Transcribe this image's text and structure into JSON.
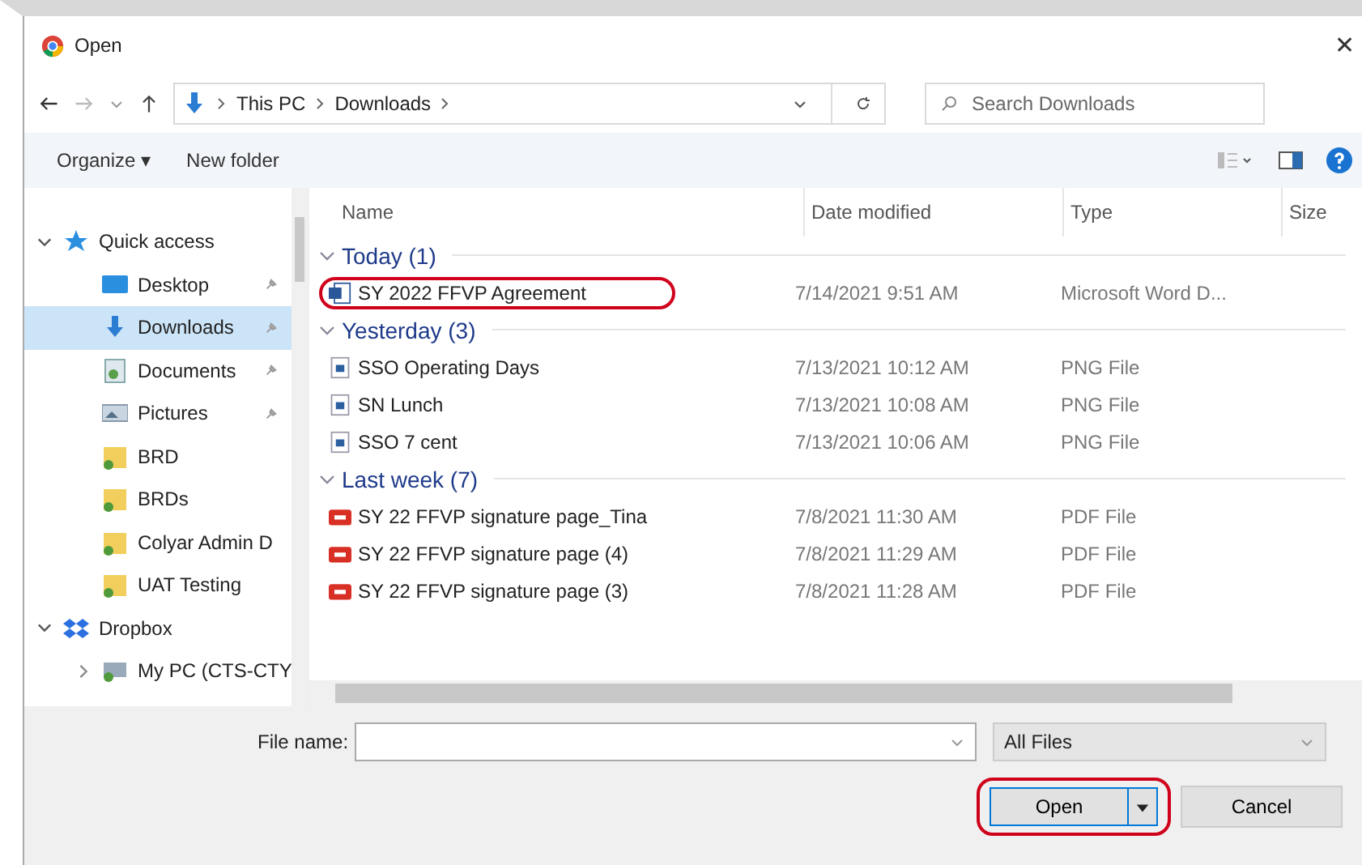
{
  "window": {
    "title": "Open",
    "close": "✕"
  },
  "address": {
    "crumbs": [
      "This PC",
      "Downloads"
    ],
    "search_placeholder": "Search Downloads"
  },
  "toolbar": {
    "organize": "Organize ▾",
    "new_folder": "New folder"
  },
  "sidebar": [
    {
      "label": "Quick access",
      "kind": "star",
      "expanded": true,
      "selected": false,
      "children": [
        {
          "label": "Desktop",
          "kind": "desktop",
          "pinned": true,
          "selected": false
        },
        {
          "label": "Downloads",
          "kind": "download",
          "pinned": true,
          "selected": true
        },
        {
          "label": "Documents",
          "kind": "document",
          "pinned": true,
          "selected": false
        },
        {
          "label": "Pictures",
          "kind": "pictures",
          "pinned": true,
          "selected": false
        },
        {
          "label": "BRD",
          "kind": "folder",
          "pinned": false,
          "selected": false
        },
        {
          "label": "BRDs",
          "kind": "folder",
          "pinned": false,
          "selected": false
        },
        {
          "label": "Colyar Admin D",
          "kind": "folder",
          "pinned": false,
          "selected": false
        },
        {
          "label": "UAT Testing",
          "kind": "folder",
          "pinned": false,
          "selected": false
        }
      ]
    },
    {
      "label": "Dropbox",
      "kind": "dropbox",
      "expanded": true,
      "selected": false,
      "children": [
        {
          "label": "My PC (CTS-CTY",
          "kind": "pc",
          "expanded": false,
          "selected": false
        }
      ]
    }
  ],
  "columns": [
    "Name",
    "Date modified",
    "Type",
    "Size"
  ],
  "groups": [
    {
      "label": "Today (1)",
      "files": [
        {
          "name": "SY 2022 FFVP Agreement",
          "date": "7/14/2021 9:51 AM",
          "type": "Microsoft Word D...",
          "kind": "word",
          "highlighted": true
        }
      ]
    },
    {
      "label": "Yesterday (3)",
      "files": [
        {
          "name": "SSO Operating Days",
          "date": "7/13/2021 10:12 AM",
          "type": "PNG File",
          "kind": "png",
          "highlighted": false
        },
        {
          "name": "SN Lunch",
          "date": "7/13/2021 10:08 AM",
          "type": "PNG File",
          "kind": "png",
          "highlighted": false
        },
        {
          "name": "SSO 7 cent",
          "date": "7/13/2021 10:06 AM",
          "type": "PNG File",
          "kind": "png",
          "highlighted": false
        }
      ]
    },
    {
      "label": "Last week (7)",
      "files": [
        {
          "name": "SY 22 FFVP signature page_Tina",
          "date": "7/8/2021 11:30 AM",
          "type": "PDF File",
          "kind": "pdf",
          "highlighted": false
        },
        {
          "name": "SY 22 FFVP signature page (4)",
          "date": "7/8/2021 11:29 AM",
          "type": "PDF File",
          "kind": "pdf",
          "highlighted": false
        },
        {
          "name": "SY 22 FFVP signature page (3)",
          "date": "7/8/2021 11:28 AM",
          "type": "PDF File",
          "kind": "pdf",
          "highlighted": false
        }
      ]
    }
  ],
  "footer": {
    "file_name_label": "File name:",
    "filter": "All Files",
    "open": "Open",
    "open_highlighted": true,
    "cancel": "Cancel"
  }
}
